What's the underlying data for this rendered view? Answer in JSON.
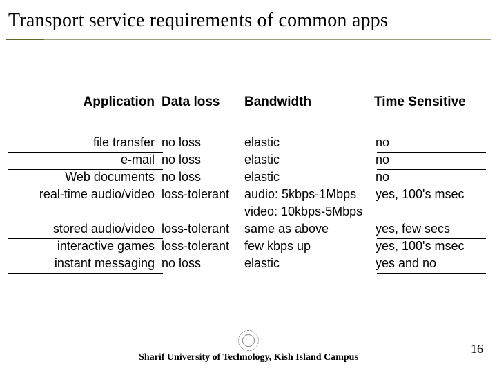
{
  "title": "Transport service requirements of common apps",
  "headers": {
    "app": "Application",
    "loss": "Data loss",
    "bw": "Bandwidth",
    "time": "Time Sensitive"
  },
  "rows": [
    {
      "app": "file transfer",
      "loss": "no loss",
      "bw": "elastic",
      "time": "no"
    },
    {
      "app": "e-mail",
      "loss": "no loss",
      "bw": "elastic",
      "time": "no"
    },
    {
      "app": "Web documents",
      "loss": "no loss",
      "bw": "elastic",
      "time": "no"
    },
    {
      "app": "real-time audio/video",
      "loss": "loss-tolerant",
      "bw": "audio: 5kbps-1Mbps",
      "time": "yes, 100's msec"
    },
    {
      "app": "",
      "loss": "",
      "bw": "video: 10kbps-5Mbps",
      "time": ""
    },
    {
      "app": "stored audio/video",
      "loss": "loss-tolerant",
      "bw": "same as above",
      "time": "yes, few secs"
    },
    {
      "app": "interactive games",
      "loss": "loss-tolerant",
      "bw": "few kbps up",
      "time": "yes, 100's msec"
    },
    {
      "app": "instant messaging",
      "loss": "no loss",
      "bw": "elastic",
      "time": "yes and no"
    }
  ],
  "footer": "Sharif University of Technology, Kish Island Campus",
  "page_number": "16"
}
